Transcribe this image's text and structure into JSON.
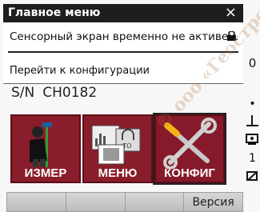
{
  "title_bar": {
    "title": "Главное меню",
    "close": "×"
  },
  "notification": {
    "message": "Сенсорный экран временно не активен.",
    "link": "Перейти к конфигурации",
    "icon": "lock-icon"
  },
  "status": {
    "sn_label": "S/N",
    "sn_value": "CH0182"
  },
  "main_buttons": [
    {
      "label": "ИЗМЕР",
      "icon": "surveyor-icon"
    },
    {
      "label": "МЕНЮ",
      "icon": "menu-icon"
    },
    {
      "label": "КОНФИГ",
      "icon": "tools-icon"
    }
  ],
  "softkeys": [
    "",
    "",
    "",
    "Версия"
  ],
  "right_column": {
    "top_digit": "0",
    "bottom_digit": "1"
  },
  "watermark": "© ooo «Геостройизыскания» ГЕОСТ",
  "colors": {
    "button": "#8a1d2b",
    "titlebar": "#1e1e1e"
  }
}
